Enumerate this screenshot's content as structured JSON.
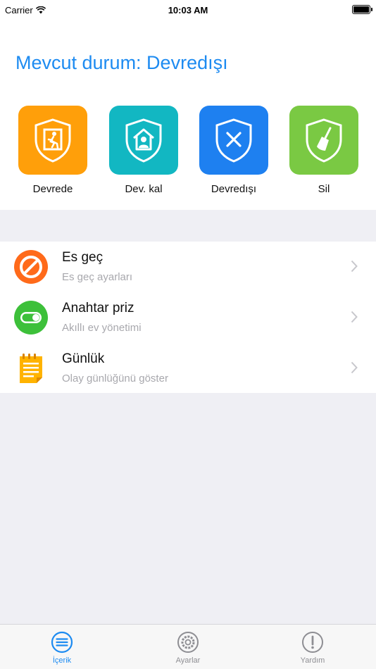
{
  "status_bar": {
    "carrier": "Carrier",
    "time": "10:03 AM"
  },
  "header": {
    "title": "Mevcut durum: Devredışı"
  },
  "actions": [
    {
      "label": "Devrede",
      "icon": "shield-exit-icon",
      "color": "#ff9f0a"
    },
    {
      "label": "Dev. kal",
      "icon": "shield-home-icon",
      "color": "#12b7c2"
    },
    {
      "label": "Devredışı",
      "icon": "shield-x-icon",
      "color": "#1e80f0"
    },
    {
      "label": "Sil",
      "icon": "shield-broom-icon",
      "color": "#7ac943"
    }
  ],
  "menu": [
    {
      "title": "Es geç",
      "subtitle": "Es geç ayarları",
      "icon": "prohibited-icon"
    },
    {
      "title": "Anahtar priz",
      "subtitle": "Akıllı ev yönetimi",
      "icon": "toggle-switch-icon"
    },
    {
      "title": "Günlük",
      "subtitle": "Olay günlüğünü göster",
      "icon": "notepad-icon"
    }
  ],
  "tabs": [
    {
      "label": "İçerik",
      "icon": "list-icon",
      "active": true
    },
    {
      "label": "Ayarlar",
      "icon": "gear-icon",
      "active": false
    },
    {
      "label": "Yardım",
      "icon": "exclamation-icon",
      "active": false
    }
  ],
  "colors": {
    "accent": "#1d8bf1",
    "background": "#efeff4",
    "inactive": "#8e8e93"
  }
}
